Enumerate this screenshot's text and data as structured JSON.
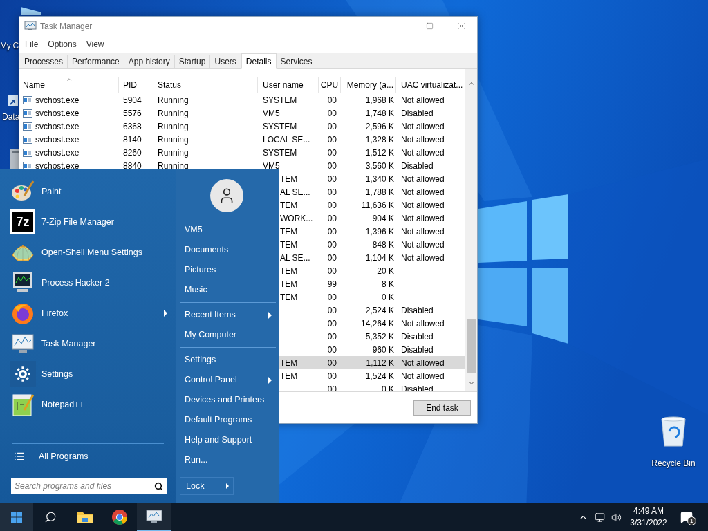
{
  "desktop": {
    "icons": [
      {
        "kind": "computer",
        "label": "My C"
      },
      {
        "kind": "shortcut",
        "label": "Data"
      },
      {
        "kind": "tower"
      },
      {
        "kind": "recycle_bin",
        "label": "Recycle Bin"
      }
    ]
  },
  "task_manager": {
    "title": "Task Manager",
    "menu": [
      "File",
      "Options",
      "View"
    ],
    "tabs": [
      {
        "label": "Processes",
        "selected": false
      },
      {
        "label": "Performance",
        "selected": false
      },
      {
        "label": "App history",
        "selected": false
      },
      {
        "label": "Startup",
        "selected": false
      },
      {
        "label": "Users",
        "selected": false
      },
      {
        "label": "Details",
        "selected": true
      },
      {
        "label": "Services",
        "selected": false
      }
    ],
    "table": {
      "columns": [
        "Name",
        "PID",
        "Status",
        "User name",
        "CPU",
        "Memory (a...",
        "UAC virtualizat..."
      ],
      "rows": [
        {
          "name": "svchost.exe",
          "pid": "5904",
          "status": "Running",
          "user": "SYSTEM",
          "cpu": "00",
          "memory": "1,968 K",
          "uac": "Not allowed",
          "covered": false,
          "selected": false
        },
        {
          "name": "svchost.exe",
          "pid": "5576",
          "status": "Running",
          "user": "VM5",
          "cpu": "00",
          "memory": "1,748 K",
          "uac": "Disabled",
          "covered": false,
          "selected": false
        },
        {
          "name": "svchost.exe",
          "pid": "6368",
          "status": "Running",
          "user": "SYSTEM",
          "cpu": "00",
          "memory": "2,596 K",
          "uac": "Not allowed",
          "covered": false,
          "selected": false
        },
        {
          "name": "svchost.exe",
          "pid": "8140",
          "status": "Running",
          "user": "LOCAL SE...",
          "cpu": "00",
          "memory": "1,328 K",
          "uac": "Not allowed",
          "covered": false,
          "selected": false
        },
        {
          "name": "svchost.exe",
          "pid": "8260",
          "status": "Running",
          "user": "SYSTEM",
          "cpu": "00",
          "memory": "1,512 K",
          "uac": "Not allowed",
          "covered": false,
          "selected": false
        },
        {
          "name": "svchost.exe",
          "pid": "8840",
          "status": "Running",
          "user": "VM5",
          "cpu": "00",
          "memory": "3,560 K",
          "uac": "Disabled",
          "covered": false,
          "selected": false
        },
        {
          "user": "TEM",
          "cpu": "00",
          "memory": "1,340 K",
          "uac": "Not allowed",
          "covered": true,
          "selected": false
        },
        {
          "user": "AL SE...",
          "cpu": "00",
          "memory": "1,788 K",
          "uac": "Not allowed",
          "covered": true,
          "selected": false
        },
        {
          "user": "TEM",
          "cpu": "00",
          "memory": "11,636 K",
          "uac": "Not allowed",
          "covered": true,
          "selected": false
        },
        {
          "user": "WORK...",
          "cpu": "00",
          "memory": "904 K",
          "uac": "Not allowed",
          "covered": true,
          "selected": false
        },
        {
          "user": "TEM",
          "cpu": "00",
          "memory": "1,396 K",
          "uac": "Not allowed",
          "covered": true,
          "selected": false
        },
        {
          "user": "TEM",
          "cpu": "00",
          "memory": "848 K",
          "uac": "Not allowed",
          "covered": true,
          "selected": false
        },
        {
          "user": "AL SE...",
          "cpu": "00",
          "memory": "1,104 K",
          "uac": "Not allowed",
          "covered": true,
          "selected": false
        },
        {
          "user": "TEM",
          "cpu": "00",
          "memory": "20 K",
          "covered": true,
          "selected": false
        },
        {
          "user": "TEM",
          "cpu": "99",
          "memory": "8 K",
          "covered": true,
          "selected": false
        },
        {
          "user": "TEM",
          "cpu": "00",
          "memory": "0 K",
          "covered": true,
          "selected": false
        },
        {
          "cpu": "00",
          "memory": "2,524 K",
          "uac": "Disabled",
          "selected": false
        },
        {
          "cpu": "00",
          "memory": "14,264 K",
          "uac": "Not allowed",
          "selected": false
        },
        {
          "cpu": "00",
          "memory": "5,352 K",
          "uac": "Disabled",
          "selected": false
        },
        {
          "cpu": "00",
          "memory": "960 K",
          "uac": "Disabled",
          "selected": false
        },
        {
          "user": "TEM",
          "cpu": "00",
          "memory": "1,112 K",
          "uac": "Not allowed",
          "covered": true,
          "selected": true
        },
        {
          "user": "TEM",
          "cpu": "00",
          "memory": "1,524 K",
          "uac": "Not allowed",
          "covered": true,
          "selected": false
        },
        {
          "cpu": "00",
          "memory": "0 K",
          "uac": "Disabled",
          "selected": false
        }
      ]
    },
    "end_task": "End task"
  },
  "start_menu": {
    "pinned": [
      {
        "kind": "paint",
        "label": "Paint",
        "submenu": false
      },
      {
        "kind": "sevenzip",
        "label": "7-Zip File Manager",
        "logo_text": "7z",
        "submenu": false
      },
      {
        "kind": "shell",
        "label": "Open-Shell Menu Settings",
        "submenu": false
      },
      {
        "kind": "process_hacker",
        "label": "Process Hacker 2",
        "submenu": false
      },
      {
        "kind": "firefox",
        "label": "Firefox",
        "submenu": true
      },
      {
        "kind": "task_manager",
        "label": "Task Manager",
        "submenu": false
      },
      {
        "kind": "settings",
        "label": "Settings",
        "submenu": false
      },
      {
        "kind": "notepadpp",
        "label": "Notepad++",
        "submenu": false
      }
    ],
    "all_programs": "All Programs",
    "search": {
      "placeholder": "Search programs and files"
    },
    "place_groups": [
      [
        {
          "label": "VM5",
          "submenu": false
        },
        {
          "label": "Documents",
          "submenu": false
        },
        {
          "label": "Pictures",
          "submenu": false
        },
        {
          "label": "Music",
          "submenu": false
        }
      ],
      [
        {
          "label": "Recent Items",
          "submenu": true
        },
        {
          "label": "My Computer",
          "submenu": false
        }
      ],
      [
        {
          "label": "Settings",
          "submenu": false
        },
        {
          "label": "Control Panel",
          "submenu": true
        },
        {
          "label": "Devices and Printers",
          "submenu": false
        },
        {
          "label": "Default Programs",
          "submenu": false
        },
        {
          "label": "Help and Support",
          "submenu": false
        },
        {
          "label": "Run...",
          "submenu": false
        }
      ]
    ],
    "lock": "Lock"
  },
  "taskbar": {
    "apps": [
      {
        "kind": "start",
        "active": true
      },
      {
        "kind": "search",
        "active": false
      },
      {
        "kind": "explorer",
        "active": false
      },
      {
        "kind": "chrome",
        "active": false
      },
      {
        "kind": "task_manager",
        "active": true
      }
    ],
    "clock": {
      "time": "4:49 AM",
      "date": "3/31/2022"
    },
    "notifications": "1"
  }
}
